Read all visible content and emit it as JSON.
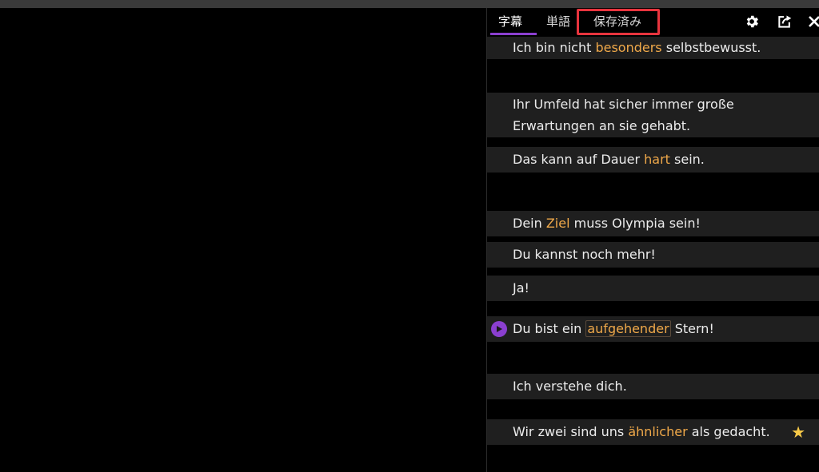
{
  "tabs": [
    {
      "label": "字幕",
      "active": true
    },
    {
      "label": "単語",
      "active": false
    },
    {
      "label": "保存済み",
      "active": false
    }
  ],
  "toolbar": {
    "icons": [
      "gear-icon",
      "export-icon",
      "close-icon"
    ]
  },
  "subtitles": [
    {
      "parts": [
        {
          "t": "Ich bin nicht "
        },
        {
          "t": "besonders",
          "hl": true
        },
        {
          "t": " selbstbewusst."
        }
      ]
    },
    {
      "lines": [
        "Ihr Umfeld hat sicher immer große",
        "Erwartungen an sie gehabt."
      ]
    },
    {
      "parts": [
        {
          "t": "Das kann auf Dauer "
        },
        {
          "t": "hart",
          "hl": true
        },
        {
          "t": " sein."
        }
      ]
    },
    {
      "parts": [
        {
          "t": "Dein "
        },
        {
          "t": "Ziel",
          "hl": true
        },
        {
          "t": " muss Olympia sein!"
        }
      ]
    },
    {
      "parts": [
        {
          "t": "Du kannst noch mehr!"
        }
      ]
    },
    {
      "parts": [
        {
          "t": "Ja!"
        }
      ]
    },
    {
      "parts": [
        {
          "t": "Du bist ein "
        },
        {
          "t": "aufgehender",
          "hl": true,
          "boxed": true
        },
        {
          "t": " Stern!"
        }
      ],
      "playing": true
    },
    {
      "parts": [
        {
          "t": "Ich verstehe dich."
        }
      ]
    },
    {
      "parts": [
        {
          "t": "Wir zwei sind uns "
        },
        {
          "t": "ähnlicher",
          "hl": true
        },
        {
          "t": " als gedacht."
        }
      ],
      "starred": true
    }
  ],
  "colors": {
    "accent": "#8b3fd0",
    "highlight": "#f0a94a",
    "focus_box": "#e8343e",
    "star": "#f7c948"
  }
}
